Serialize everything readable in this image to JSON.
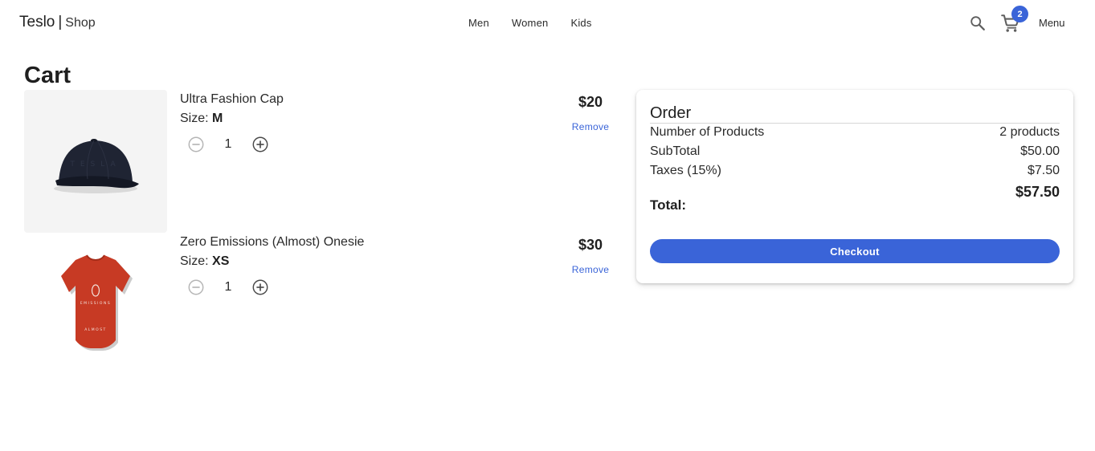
{
  "navbar": {
    "brand_name": "Teslo",
    "brand_separator": "|",
    "brand_sub": "Shop",
    "links": [
      {
        "label": "Men"
      },
      {
        "label": "Women"
      },
      {
        "label": "Kids"
      }
    ],
    "search_icon": "search-icon",
    "cart_icon": "shopping-cart-icon",
    "cart_count": "2",
    "menu_label": "Menu"
  },
  "page": {
    "title": "Cart"
  },
  "cart": {
    "items": [
      {
        "title": "Ultra Fashion Cap",
        "size_label": "Size: ",
        "size": "M",
        "quantity": "1",
        "price": "$20",
        "remove_label": "Remove",
        "image": "black-cap-image"
      },
      {
        "title": "Zero Emissions (Almost) Onesie",
        "size_label": "Size: ",
        "size": "XS",
        "quantity": "1",
        "price": "$30",
        "remove_label": "Remove",
        "image": "red-onesie-image"
      }
    ]
  },
  "order": {
    "title": "Order",
    "rows": [
      {
        "label": "Number of Products",
        "value": "2 products"
      },
      {
        "label": "SubTotal",
        "value": "$50.00"
      },
      {
        "label": "Taxes (15%)",
        "value": "$7.50"
      }
    ],
    "total_label": "Total:",
    "total_value": "$57.50",
    "checkout_label": "Checkout"
  },
  "colors": {
    "accent": "#3a64d8",
    "text": "#1f1f1f",
    "image_bg": "#f4f4f4"
  }
}
